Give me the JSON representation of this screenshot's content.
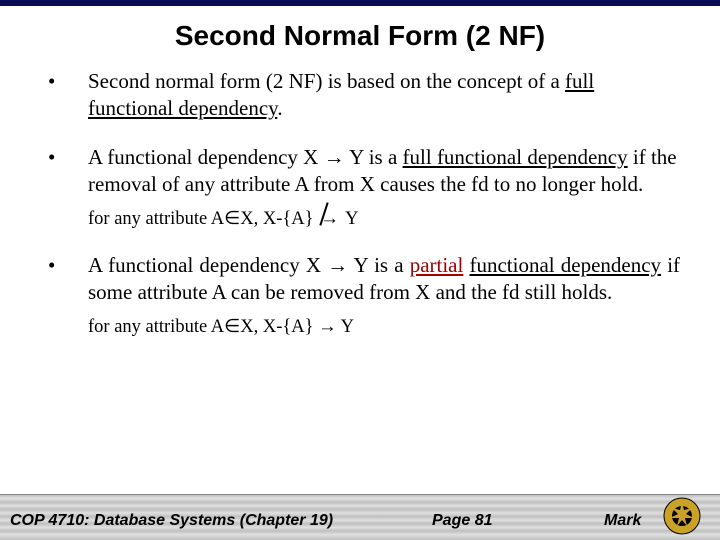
{
  "title": "Second Normal Form (2 NF)",
  "bullets": {
    "b1": {
      "pre": "Second normal form (2 NF) is based on the concept of a ",
      "u": "full functional dependency",
      "post": "."
    },
    "b2": {
      "pre": "A functional dependency X ",
      "arrow": "→",
      "mid": " Y is a ",
      "u": "full functional dependency",
      "post": " if the removal of any attribute A from X causes the fd to no longer hold."
    },
    "sub2": {
      "pre": "for any attribute A",
      "in": "∈",
      "mid": "X, X-{A} ",
      "arrow": "→",
      "post": " Y"
    },
    "b3": {
      "pre": "A functional dependency X ",
      "arrow": "→",
      "mid1": " Y is a ",
      "red": "partial",
      "mid2": " ",
      "u": "functional dependency",
      "post": " if some attribute A can be removed from X and the fd still holds."
    },
    "sub3": {
      "pre": "for any attribute A",
      "in": "∈",
      "mid": "X, X-{A} ",
      "arrow": "→",
      "post": " Y"
    }
  },
  "footer": {
    "course": "COP 4710: Database Systems  (Chapter 19)",
    "page": "Page 81",
    "name": "Mark"
  }
}
